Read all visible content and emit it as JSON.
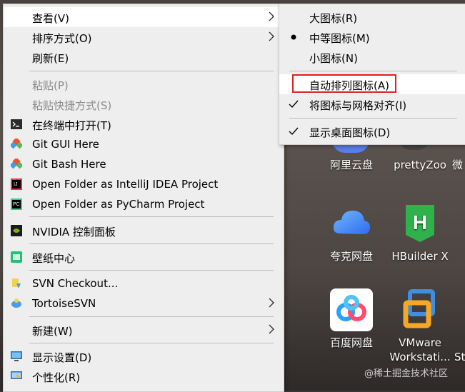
{
  "menu": {
    "view": "查看(V)",
    "sort": "排序方式(O)",
    "refresh": "刷新(E)",
    "paste": "粘贴(P)",
    "paste_shortcut": "粘贴快捷方式(S)",
    "terminal": "在终端中打开(T)",
    "git_gui": "Git GUI Here",
    "git_bash": "Git Bash Here",
    "idea": "Open Folder as IntelliJ IDEA Project",
    "pycharm": "Open Folder as PyCharm Project",
    "nvidia": "NVIDIA 控制面板",
    "wallpaper": "壁纸中心",
    "svn_checkout": "SVN Checkout...",
    "tortoise": "TortoiseSVN",
    "new": "新建(W)",
    "display": "显示设置(D)",
    "personalize": "个性化(R)"
  },
  "submenu": {
    "large": "大图标(R)",
    "medium": "中等图标(M)",
    "small": "小图标(N)",
    "auto_arrange": "自动排列图标(A)",
    "align_grid": "将图标与网格对齐(I)",
    "show_icons": "显示桌面图标(D)"
  },
  "desktop": {
    "aliyun": "阿里云盘",
    "prettyzoo": "prettyZoo",
    "wei": "微",
    "quark": "夸克网盘",
    "hbuilder": "HBuilder X",
    "baidu": "百度网盘",
    "vmware_1": "VMware",
    "vmware_2": "Workstati...",
    "st": "St"
  },
  "watermark": "@稀土掘金技术社区",
  "colors": {
    "menu_bg": "#eeeeee",
    "hover_bg": "#ffffff",
    "highlight": "#e02020",
    "disabled_text": "#8a8a8a"
  }
}
